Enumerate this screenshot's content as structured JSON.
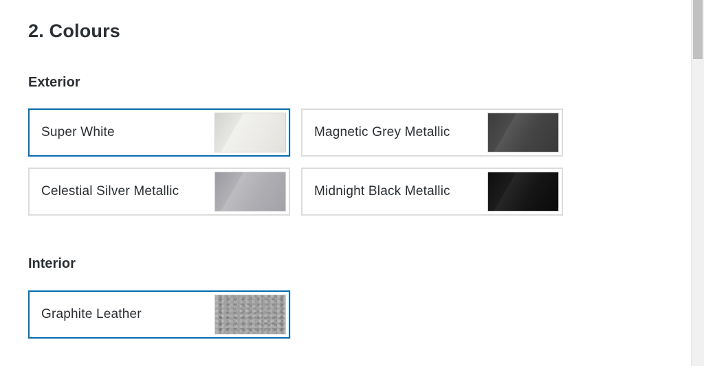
{
  "section": {
    "title": "2. Colours"
  },
  "exterior": {
    "title": "Exterior",
    "options": [
      {
        "label": "Super White",
        "selected": true,
        "chip_color": "#e6e6e3"
      },
      {
        "label": "Magnetic Grey Metallic",
        "selected": false,
        "chip_color": "#4a4a4a"
      },
      {
        "label": "Celestial Silver Metallic",
        "selected": false,
        "chip_color": "#b0b0b5"
      },
      {
        "label": "Midnight Black Metallic",
        "selected": false,
        "chip_color": "#1a1a1a"
      }
    ]
  },
  "interior": {
    "title": "Interior",
    "options": [
      {
        "label": "Graphite Leather",
        "selected": true,
        "chip_color": "#a0a0a0"
      }
    ]
  },
  "colors": {
    "selected_border": "#0b6eb0",
    "default_border": "#dcdcdc",
    "text": "#2b2f33"
  }
}
